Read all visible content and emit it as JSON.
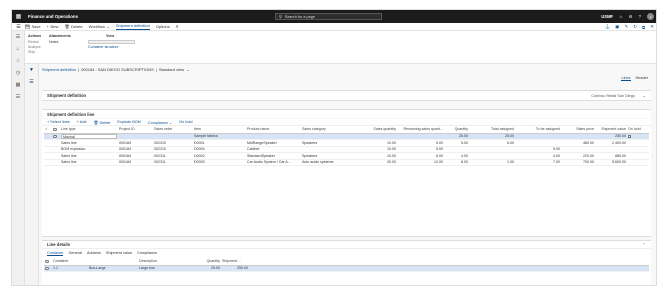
{
  "app": {
    "title": "Finance and Operations",
    "search_placeholder": "Search for a page",
    "company": "USMF",
    "user_initials": "A"
  },
  "actions": {
    "save": "Save",
    "new": "New",
    "delete": "Delete",
    "workflow": "Workflow",
    "active_tab": "Shipment definition",
    "options": "Options"
  },
  "ribbon": {
    "group1_header": "Actions",
    "group1_items": [
      "Revise",
      "Analyze",
      "Ship"
    ],
    "group2_header": "Attachments",
    "group2_items": [
      "Notes"
    ],
    "group3_header": "View",
    "group3_items": [
      "Container structure"
    ]
  },
  "breadcrumb": {
    "link": "Shipment definition",
    "sep1": "|",
    "record": "000184 : SAN DIEGO SUBSCRIPTIONS",
    "sep2": "|",
    "view": "Standard view"
  },
  "view_tabs": {
    "lines": "Lines",
    "header": "Header"
  },
  "shipment_definition": {
    "title": "Shipment definition",
    "value": "Contoso Retail San Diego"
  },
  "lines_section": {
    "title": "Shipment definition line",
    "toolbar": [
      "Select lines",
      "Add",
      "Delete",
      "Explode BOM",
      "Compliance",
      "On hold"
    ],
    "columns": [
      "Line type",
      "Project ID",
      "Sales order",
      "Item",
      "Product name",
      "Sales category",
      "Sales quantity",
      "Remaining sales quant...",
      "Quantity",
      "Total assigned",
      "To be assigned",
      "Sales price",
      "Shipment value",
      "On hold"
    ],
    "rows": [
      [
        "Manual",
        "",
        "",
        "Sample fabrics",
        "",
        "",
        "",
        "",
        "25.00",
        "25.00",
        "",
        "",
        "250.00",
        ""
      ],
      [
        "Sales line",
        "000184",
        "002310",
        "D0001",
        "MidRangeSpeaker",
        "Speakers",
        "10.00",
        "5.00",
        "5.00",
        "5.00",
        "",
        "480.00",
        "2,400.00",
        ""
      ],
      [
        "BOM explosion",
        "000184",
        "002310",
        "D0004",
        "Cabinet",
        "",
        "10.00",
        "5.00",
        "",
        "",
        "5.00",
        "",
        "",
        ""
      ],
      [
        "Sales line",
        "000184",
        "002311",
        "D0002",
        "StandardSpeaker",
        "Speakers",
        "10.00",
        "6.00",
        "4.00",
        "",
        "4.00",
        "220.00",
        "880.00",
        ""
      ],
      [
        "Sales line",
        "000184",
        "002311",
        "D0003",
        "Car Audio System / Car A...",
        "Auto audio systems",
        "20.00",
        "12.00",
        "8.00",
        "1.00",
        "7.00",
        "700.00",
        "5,600.00",
        ""
      ]
    ]
  },
  "line_details": {
    "title": "Line details",
    "tabs": [
      "Container",
      "General",
      "Address",
      "Shipment value",
      "Compliance"
    ],
    "columns": [
      "Container",
      "Description",
      "Quantity",
      "Shipment ..."
    ],
    "rows": [
      [
        "1.1",
        "Box-Large",
        "Large box",
        "25.00",
        "250.00"
      ]
    ]
  }
}
